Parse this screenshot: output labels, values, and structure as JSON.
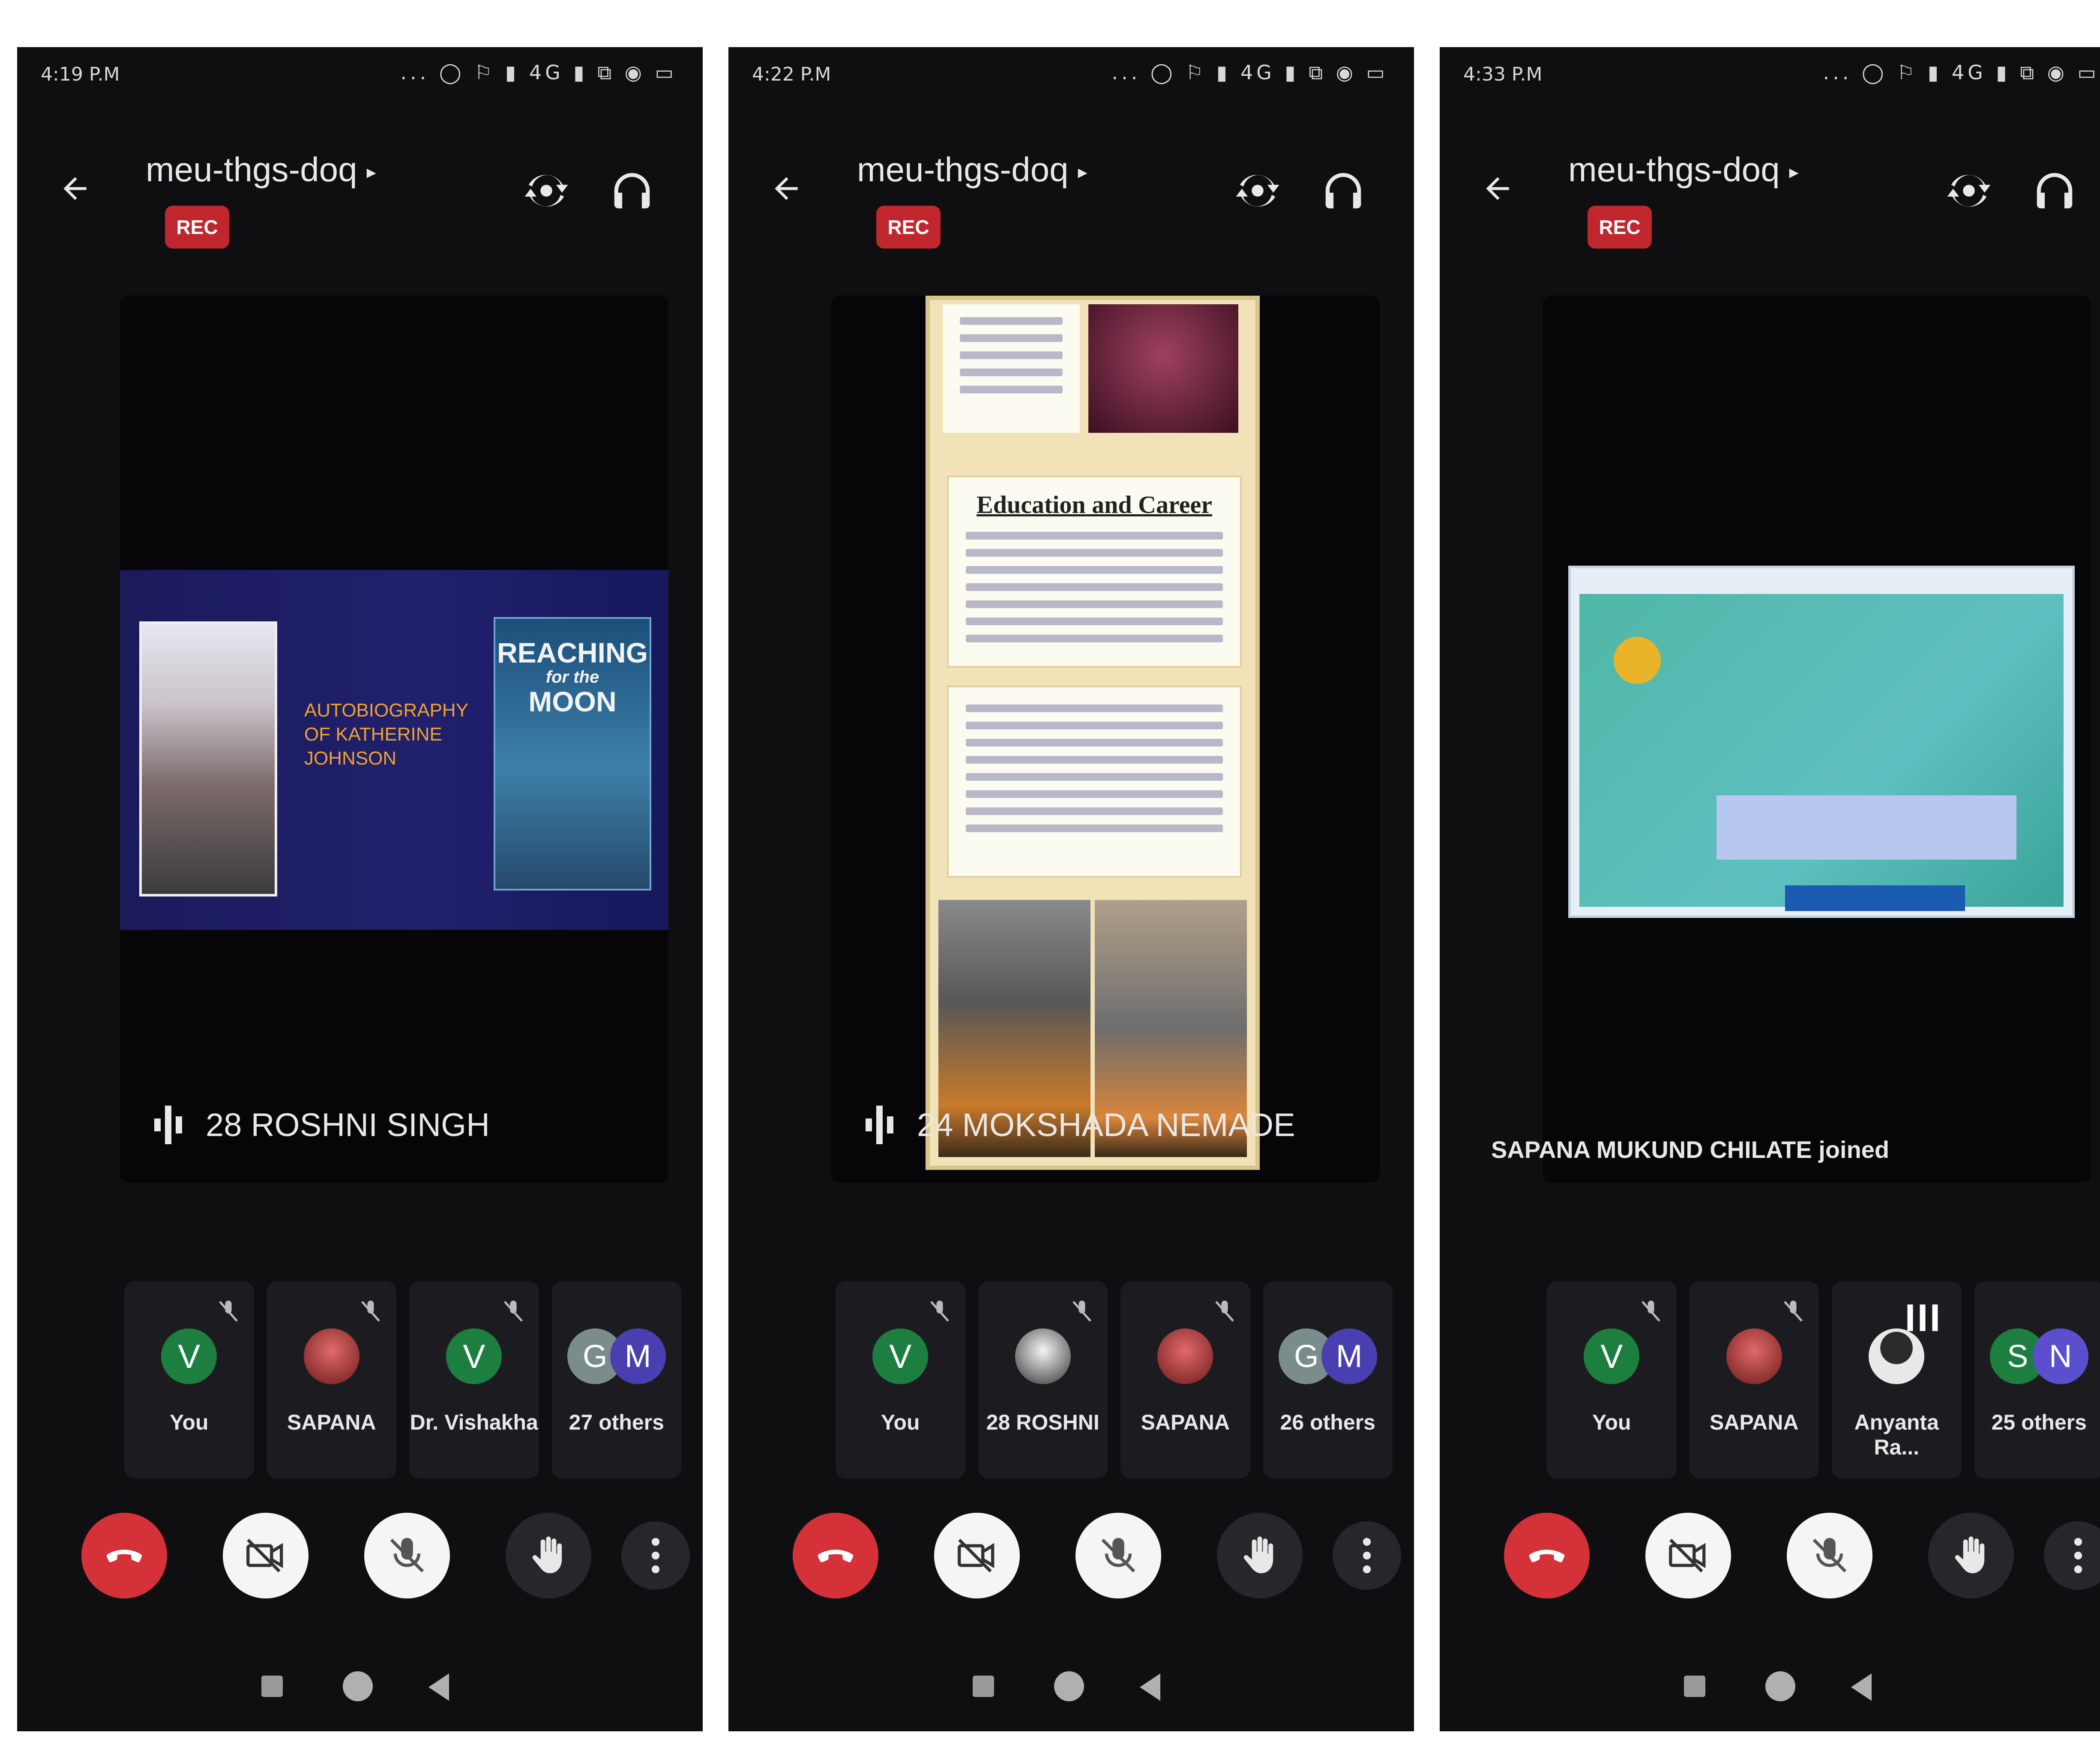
{
  "phones": [
    {
      "status_time": "4:19 P.M",
      "status_icons": "... ◯ ⚐ ▮ 4G ▮ ⧉ ◉ ▭",
      "meeting_code": "meu-thgs-doq",
      "caret": "▸",
      "rec": "REC",
      "slide": {
        "text": [
          "AUTOBIOGRAPHY",
          "OF KATHERINE",
          "JOHNSON"
        ],
        "book_title_top": "REACHING",
        "book_title_small": "for the",
        "book_title_bottom": "MOON"
      },
      "speaker": "28 ROSHNI SINGH",
      "tiles": [
        {
          "type": "avatar",
          "initial": "V",
          "label": "You"
        },
        {
          "type": "photo",
          "label": "SAPANA"
        },
        {
          "type": "avatar",
          "initial": "V",
          "label": "Dr. Vishakha"
        },
        {
          "type": "pair",
          "initials": [
            "G",
            "M"
          ],
          "label": "27 others"
        }
      ],
      "colors": {
        "end_call": "#d53138",
        "rec": "#c0262e"
      }
    },
    {
      "status_time": "4:22 P.M",
      "status_icons": "... ◯ ⚐ ▮ 4G ▮ ⧉ ◉ ▭",
      "meeting_code": "meu-thgs-doq",
      "caret": "▸",
      "rec": "REC",
      "poster": {
        "title": "Education and Career"
      },
      "speaker": "24 MOKSHADA NEMADE",
      "tiles": [
        {
          "type": "avatar",
          "initial": "V",
          "label": "You"
        },
        {
          "type": "photo2",
          "label": "28 ROSHNI"
        },
        {
          "type": "photo",
          "label": "SAPANA"
        },
        {
          "type": "pair",
          "initials": [
            "G",
            "M"
          ],
          "label": "26 others"
        }
      ]
    },
    {
      "status_time": "4:33 P.M",
      "status_icons": "... ◯ ⚐ ▮ 4G ▮ ⧉ ◉ ▭",
      "meeting_code": "meu-thgs-doq",
      "caret": "▸",
      "rec": "REC",
      "joined_toast": "SAPANA MUKUND CHILATE joined",
      "tiles": [
        {
          "type": "avatar",
          "initial": "V",
          "label": "You"
        },
        {
          "type": "photo",
          "label": "SAPANA"
        },
        {
          "type": "silhouette",
          "label": "Anyanta Ra...",
          "hand": "III"
        },
        {
          "type": "pair",
          "initials": [
            "S",
            "N"
          ],
          "label": "25 others"
        }
      ]
    }
  ]
}
